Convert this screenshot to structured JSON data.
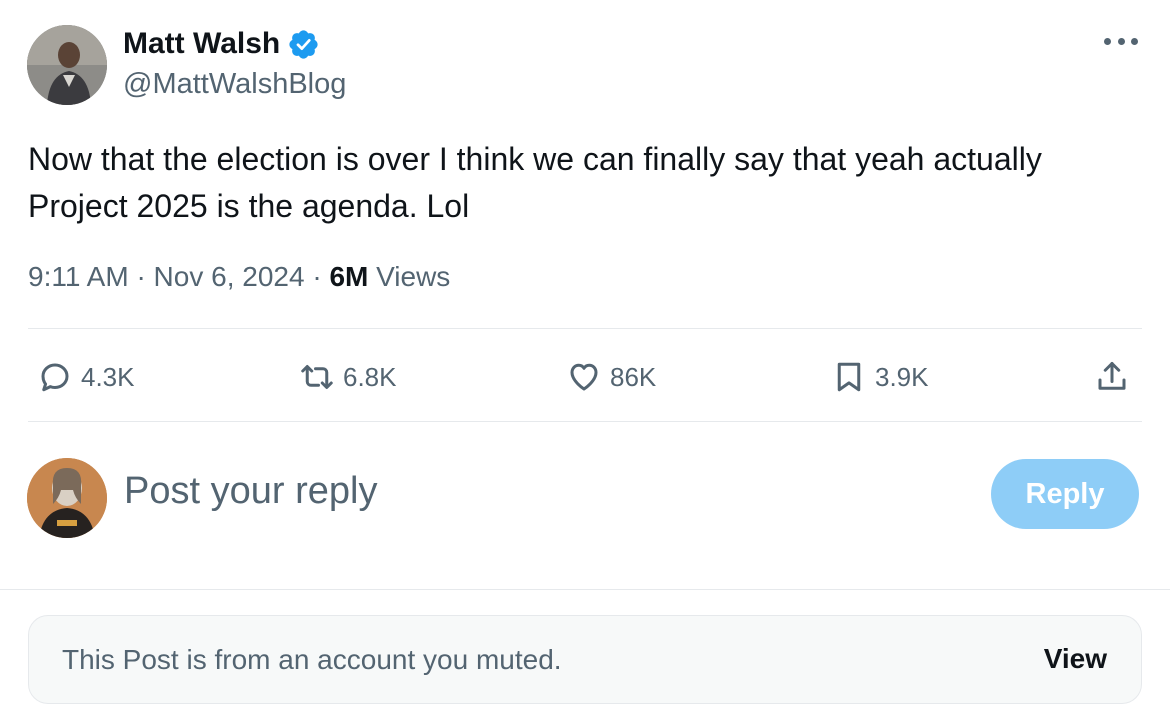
{
  "post": {
    "author": {
      "name": "Matt Walsh",
      "handle": "@MattWalshBlog",
      "verified": true,
      "verified_color": "#1d9bf0",
      "avatar_icon": "author-avatar"
    },
    "text": "Now that the election is over I think we can finally say that yeah actually Project 2025 is the agenda. Lol",
    "time": "9:11 AM",
    "date": "Nov 6, 2024",
    "views_count": "6M",
    "views_label": "Views",
    "separator": "·",
    "more_icon": "more-icon"
  },
  "actions": {
    "reply": {
      "icon": "reply-icon",
      "count": "4.3K"
    },
    "retweet": {
      "icon": "retweet-icon",
      "count": "6.8K"
    },
    "like": {
      "icon": "heart-icon",
      "count": "86K"
    },
    "bookmark": {
      "icon": "bookmark-icon",
      "count": "3.9K"
    },
    "share": {
      "icon": "share-icon"
    }
  },
  "composer": {
    "placeholder": "Post your reply",
    "button_label": "Reply",
    "button_color": "#8ecdf7"
  },
  "muted_notice": {
    "text": "This Post is from an account you muted.",
    "action_label": "View"
  }
}
